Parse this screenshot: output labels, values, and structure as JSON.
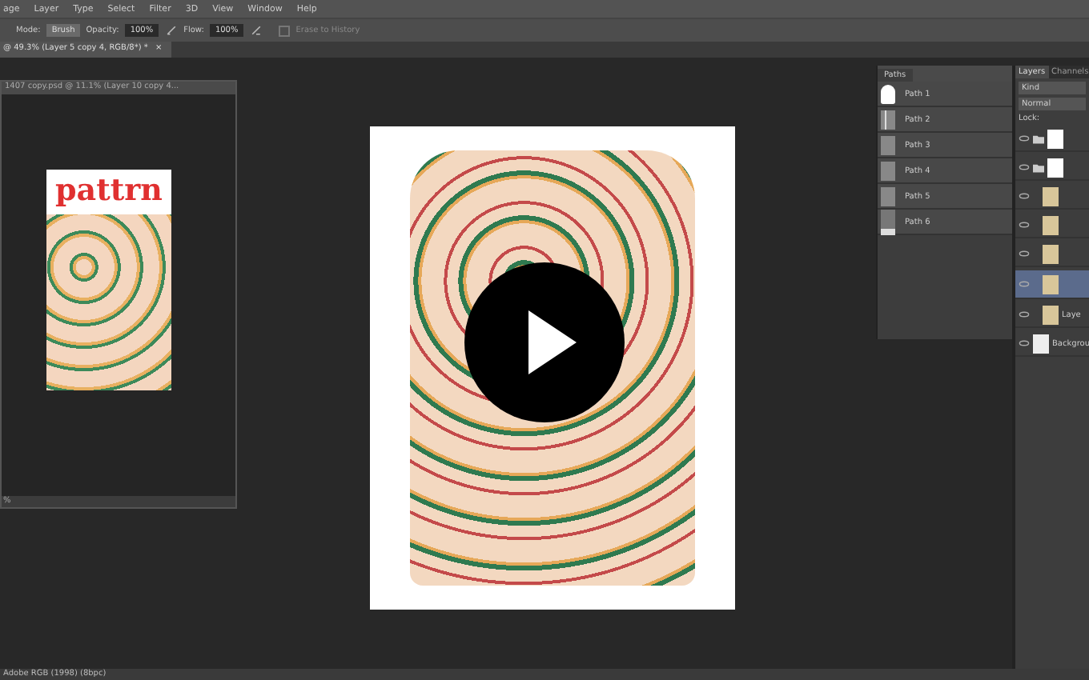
{
  "menu": [
    "age",
    "Layer",
    "Type",
    "Select",
    "Filter",
    "3D",
    "View",
    "Window",
    "Help"
  ],
  "options": {
    "mode_label": "Mode:",
    "mode": "Brush",
    "opacity_label": "Opacity:",
    "opacity": "100%",
    "flow_label": "Flow:",
    "flow": "100%",
    "erase_history": {
      "label": "Erase to History",
      "checked": false
    }
  },
  "document_tab": {
    "title": "@ 49.3% (Layer 5 copy 4, RGB/8*) *",
    "close": "×"
  },
  "floating_document": {
    "title": "1407 copy.psd @ 11.1% (Layer 10 copy 4...",
    "heading": "pattrn",
    "zoom": "%"
  },
  "paths_panel": {
    "tab": "Paths",
    "paths": [
      {
        "name": "Path 1",
        "kind": "shirt"
      },
      {
        "name": "Path 2",
        "kind": "sleeve"
      },
      {
        "name": "Path 3",
        "kind": "plain"
      },
      {
        "name": "Path 4",
        "kind": "plain"
      },
      {
        "name": "Path 5",
        "kind": "plain"
      },
      {
        "name": "Path 6",
        "kind": "small"
      }
    ]
  },
  "layers_panel": {
    "tabs": [
      {
        "label": "Layers",
        "selected": true
      },
      {
        "label": "Channels",
        "selected": false
      }
    ],
    "filter": "Kind",
    "blend": "Normal",
    "lock_label": "Lock:",
    "layers": [
      {
        "kind": "group",
        "selected": false
      },
      {
        "kind": "group",
        "selected": false
      },
      {
        "kind": "layer",
        "selected": false
      },
      {
        "kind": "layer",
        "selected": false
      },
      {
        "kind": "layer",
        "selected": false
      },
      {
        "kind": "layer",
        "selected": true
      },
      {
        "kind": "layer",
        "name": "Laye",
        "selected": false
      },
      {
        "kind": "background",
        "name": "Backgrou",
        "selected": false
      }
    ]
  },
  "status_bar": {
    "profile": "Adobe RGB (1998) (8bpc)"
  }
}
